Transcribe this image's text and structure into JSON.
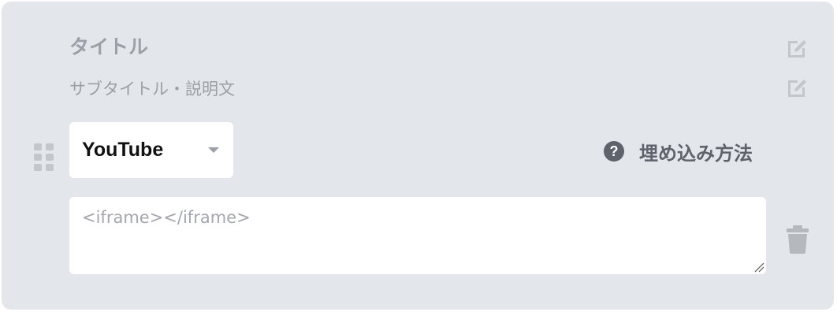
{
  "block": {
    "title": "タイトル",
    "subtitle": "サブタイトル・説明文",
    "embed_type": {
      "selected": "YouTube"
    },
    "help_link": {
      "icon_glyph": "?",
      "label": "埋め込み方法"
    },
    "embed_code": {
      "value": "",
      "placeholder": "<iframe></iframe>"
    }
  },
  "icons": {
    "edit_title": "edit-icon",
    "edit_subtitle": "edit-icon",
    "drag": "drag-handle-icon",
    "help": "question-circle-icon",
    "delete": "trash-icon"
  },
  "colors": {
    "card_background": "#e3e6ea",
    "muted_text": "#9c9fa5",
    "dark_text": "#5e636b",
    "input_background": "#ffffff"
  }
}
